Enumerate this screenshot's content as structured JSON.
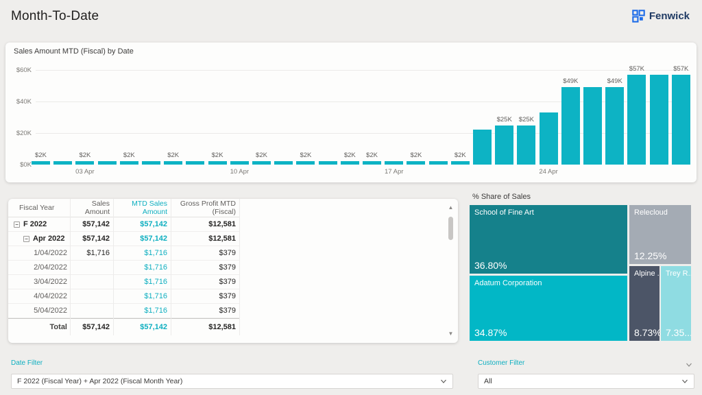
{
  "header": {
    "title": "Month-To-Date",
    "brand": "Fenwick"
  },
  "chart_data": {
    "type": "bar",
    "title": "Sales Amount MTD (Fiscal) by Date",
    "ylabel": "Sales Amount MTD (Fiscal)",
    "xlabel": "Date",
    "ylim": [
      0,
      60
    ],
    "unit": "USD thousands",
    "bar_color": "#0DB3C4",
    "grid": true,
    "x": [
      "1 Apr",
      "2 Apr",
      "3 Apr",
      "4 Apr",
      "5 Apr",
      "6 Apr",
      "7 Apr",
      "8 Apr",
      "9 Apr",
      "10 Apr",
      "11 Apr",
      "12 Apr",
      "13 Apr",
      "14 Apr",
      "15 Apr",
      "16 Apr",
      "17 Apr",
      "18 Apr",
      "19 Apr",
      "20 Apr",
      "21 Apr",
      "22 Apr",
      "23 Apr",
      "24 Apr",
      "25 Apr",
      "26 Apr",
      "27 Apr",
      "28 Apr",
      "29 Apr",
      "30 Apr"
    ],
    "values": [
      2,
      2,
      2,
      2,
      2,
      2,
      2,
      2,
      2,
      2,
      2,
      2,
      2,
      2,
      2,
      2,
      2,
      2,
      2,
      2,
      22,
      25,
      25,
      33,
      49,
      49,
      49,
      57,
      57,
      57
    ],
    "bar_labels": [
      "$2K",
      null,
      "$2K",
      null,
      "$2K",
      null,
      "$2K",
      null,
      "$2K",
      null,
      "$2K",
      null,
      "$2K",
      null,
      "$2K",
      "$2K",
      null,
      "$2K",
      null,
      "$2K",
      null,
      "$25K",
      "$25K",
      null,
      "$49K",
      null,
      "$49K",
      "$57K",
      null,
      "$57K"
    ],
    "y_ticks": [
      {
        "label": "$60K",
        "value": 60
      },
      {
        "label": "$40K",
        "value": 40
      },
      {
        "label": "$20K",
        "value": 20
      },
      {
        "label": "$0K",
        "value": 0
      }
    ],
    "x_ticks": [
      {
        "label": "03 Apr",
        "bar_index": 3
      },
      {
        "label": "10 Apr",
        "bar_index": 10
      },
      {
        "label": "17 Apr",
        "bar_index": 17
      },
      {
        "label": "24 Apr",
        "bar_index": 24
      }
    ]
  },
  "table": {
    "columns": [
      {
        "label": "Fiscal Year",
        "accent": false
      },
      {
        "label": "Sales Amount",
        "accent": false
      },
      {
        "label": "MTD Sales Amount",
        "accent": true
      },
      {
        "label": "Gross Profit MTD (Fiscal)",
        "accent": false
      }
    ],
    "rows": [
      {
        "label": "F 2022",
        "level": 0,
        "expandable": true,
        "bold": true,
        "cells": [
          "$57,142",
          "$57,142",
          "$12,581"
        ]
      },
      {
        "label": "Apr 2022",
        "level": 1,
        "expandable": true,
        "bold": true,
        "cells": [
          "$57,142",
          "$57,142",
          "$12,581"
        ]
      },
      {
        "label": "1/04/2022",
        "level": 2,
        "expandable": false,
        "bold": false,
        "cells": [
          "$1,716",
          "$1,716",
          "$379"
        ]
      },
      {
        "label": "2/04/2022",
        "level": 2,
        "expandable": false,
        "bold": false,
        "cells": [
          "",
          "$1,716",
          "$379"
        ]
      },
      {
        "label": "3/04/2022",
        "level": 2,
        "expandable": false,
        "bold": false,
        "cells": [
          "",
          "$1,716",
          "$379"
        ]
      },
      {
        "label": "4/04/2022",
        "level": 2,
        "expandable": false,
        "bold": false,
        "cells": [
          "",
          "$1,716",
          "$379"
        ]
      },
      {
        "label": "5/04/2022",
        "level": 2,
        "expandable": false,
        "bold": false,
        "cells": [
          "",
          "$1,716",
          "$379"
        ]
      },
      {
        "label": "Total",
        "level": 2,
        "expandable": false,
        "bold": true,
        "total": true,
        "cells": [
          "$57,142",
          "$57,142",
          "$12,581"
        ]
      }
    ]
  },
  "treemap": {
    "title": "% Share of Sales",
    "blocks": [
      {
        "name": "School of Fine Art",
        "pct": "36.80%",
        "color": "#15818B"
      },
      {
        "name": "Relecloud",
        "pct": "12.25%",
        "color": "#A4ABB4"
      },
      {
        "name": "Adatum Corporation",
        "pct": "34.87%",
        "color": "#02B7C6"
      },
      {
        "name": "Alpine ...",
        "pct": "8.73%",
        "color": "#4C5567"
      },
      {
        "name": "Trey R...",
        "pct": "7.35...",
        "color": "#8FDCE2"
      }
    ]
  },
  "filters": {
    "date_filter": {
      "label": "Date Filter",
      "value": "F 2022 (Fiscal Year) + Apr 2022 (Fiscal Month Year)"
    },
    "customer_filter": {
      "label": "Customer Filter",
      "value": "All"
    }
  },
  "colors": {
    "accent_teal": "#0EAFC0",
    "brand_blue": "#1E6CE8",
    "brand_navy": "#1F3A63"
  }
}
